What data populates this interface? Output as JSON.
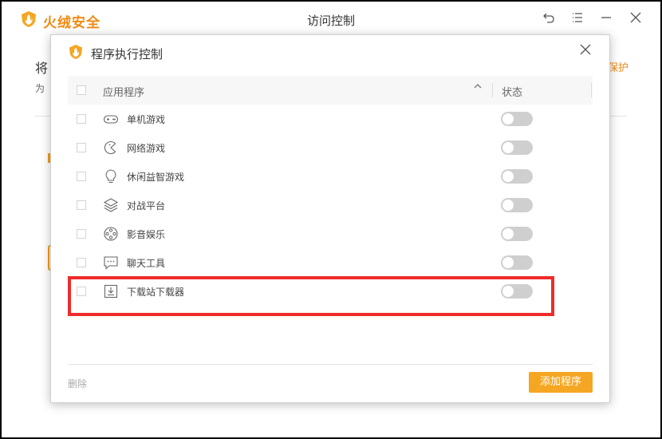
{
  "app": {
    "brand": "火绒安全",
    "window_title": "访问控制",
    "accent_color": "#f08a12"
  },
  "background": {
    "title_fragment": "将",
    "subtitle_fragment": "为",
    "link_fragment": "保护"
  },
  "dialog": {
    "title": "程序执行控制",
    "columns": {
      "app": "应用程序",
      "status": "状态"
    },
    "rows": [
      {
        "label": "单机游戏",
        "icon": "gamepad-icon",
        "enabled": false
      },
      {
        "label": "网络游戏",
        "icon": "pacman-icon",
        "enabled": false
      },
      {
        "label": "休闲益智游戏",
        "icon": "lightbulb-icon",
        "enabled": false
      },
      {
        "label": "对战平台",
        "icon": "layers-icon",
        "enabled": false
      },
      {
        "label": "影音娱乐",
        "icon": "film-reel-icon",
        "enabled": false
      },
      {
        "label": "聊天工具",
        "icon": "chat-icon",
        "enabled": false
      },
      {
        "label": "下载站下载器",
        "icon": "download-icon",
        "enabled": false
      }
    ],
    "delete_label": "删除",
    "add_label": "添加程序"
  }
}
